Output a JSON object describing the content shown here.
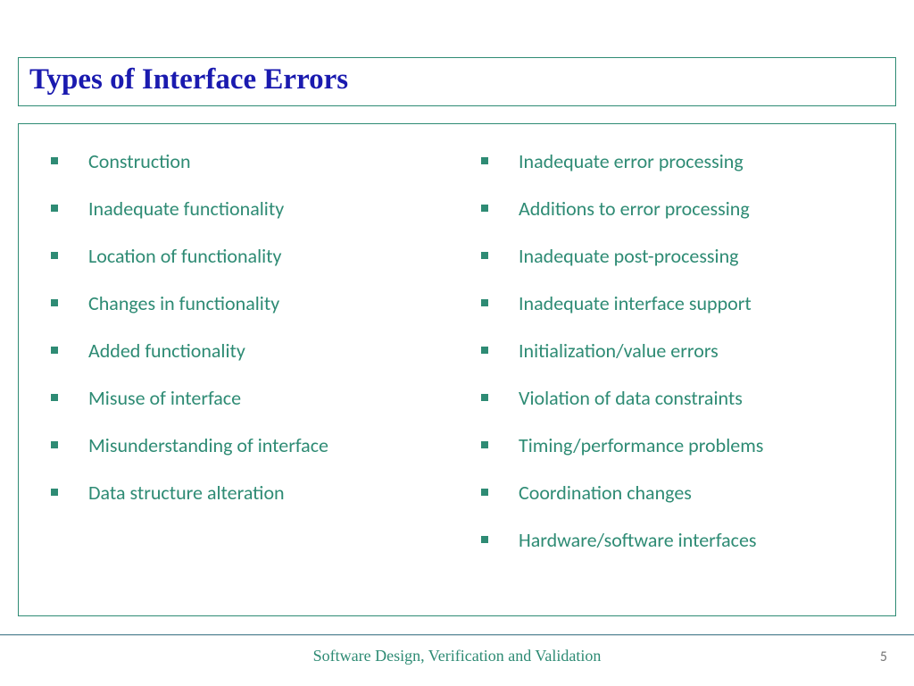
{
  "title": "Types of Interface Errors",
  "left_items": [
    "Construction",
    "Inadequate functionality",
    "Location of functionality",
    "Changes in functionality",
    "Added functionality",
    "Misuse of interface",
    "Misunderstanding of interface",
    "Data structure alteration"
  ],
  "right_items": [
    "Inadequate error processing",
    "Additions to error processing",
    "Inadequate post-processing",
    "Inadequate interface support",
    "Initialization/value errors",
    "Violation of data constraints",
    "Timing/performance problems",
    "Coordination changes",
    "Hardware/software interfaces"
  ],
  "footer": "Software Design, Verification and Validation",
  "page": "5"
}
